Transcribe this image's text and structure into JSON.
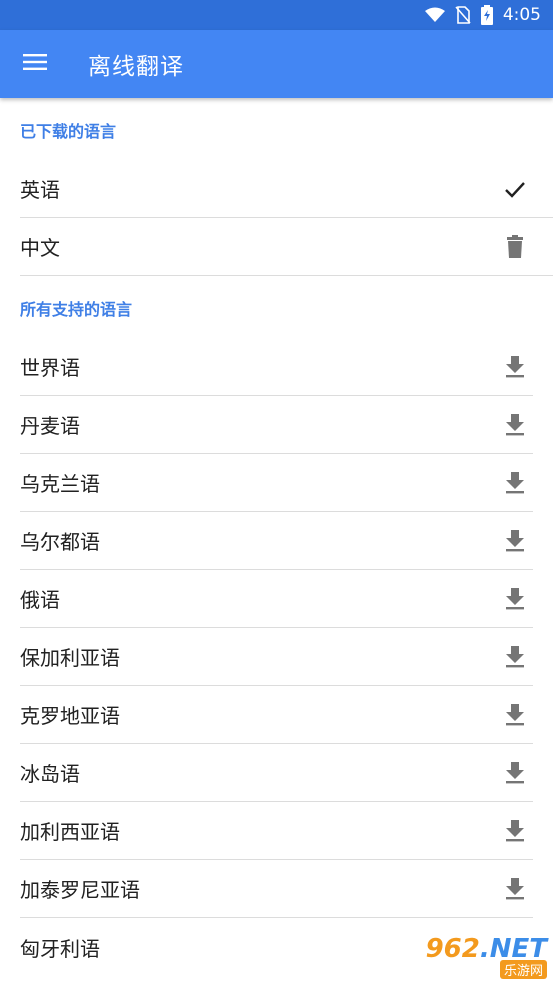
{
  "status_bar": {
    "time": "4:05",
    "icons": [
      "wifi-icon",
      "no-sim-icon",
      "battery-charging-icon"
    ]
  },
  "app_bar": {
    "menu_icon": "menu-icon",
    "title": "离线翻译",
    "background": "#4386f3"
  },
  "downloaded_section": {
    "header": "已下载的语言",
    "items": [
      {
        "label": "英语",
        "action_icon": "check-icon"
      },
      {
        "label": "中文",
        "action_icon": "delete-icon"
      }
    ]
  },
  "supported_section": {
    "header": "所有支持的语言",
    "items": [
      {
        "label": "世界语",
        "action_icon": "download-icon"
      },
      {
        "label": "丹麦语",
        "action_icon": "download-icon"
      },
      {
        "label": "乌克兰语",
        "action_icon": "download-icon"
      },
      {
        "label": "乌尔都语",
        "action_icon": "download-icon"
      },
      {
        "label": "俄语",
        "action_icon": "download-icon"
      },
      {
        "label": "保加利亚语",
        "action_icon": "download-icon"
      },
      {
        "label": "克罗地亚语",
        "action_icon": "download-icon"
      },
      {
        "label": "冰岛语",
        "action_icon": "download-icon"
      },
      {
        "label": "加利西亚语",
        "action_icon": "download-icon"
      },
      {
        "label": "加泰罗尼亚语",
        "action_icon": "download-icon"
      },
      {
        "label": "匈牙利语",
        "action_icon": "download-icon"
      }
    ]
  },
  "watermark": {
    "brand": "962",
    "tld": ".NET",
    "subtitle": "乐游网"
  },
  "colors": {
    "accent": "#4386f3",
    "section_header": "#3f7fe6",
    "icon_gray": "#757575"
  }
}
